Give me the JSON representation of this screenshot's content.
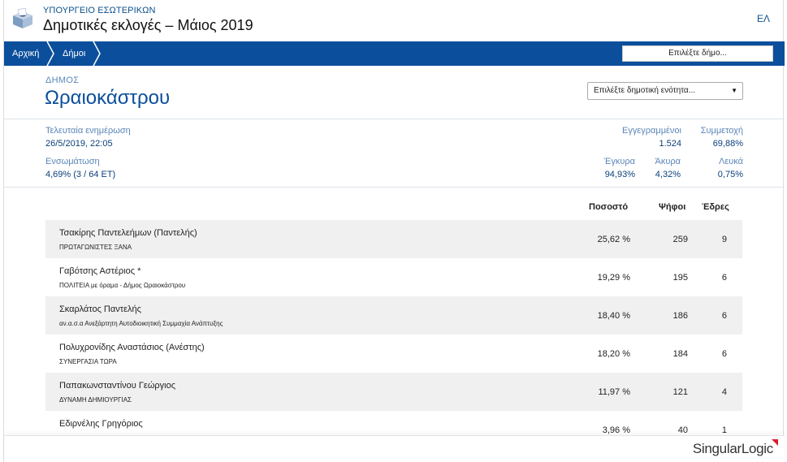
{
  "header": {
    "ministry": "ΥΠΟΥΡΓΕΙΟ ΕΣΩΤΕΡΙΚΩΝ",
    "title": "Δημοτικές εκλογές – Μάιος 2019",
    "language": "ΕΛ",
    "logo_icon": "ballot-box-icon"
  },
  "nav": {
    "breadcrumbs": [
      "Αρχική",
      "Δήμοι"
    ],
    "municipality_select_placeholder": "Επιλέξτε δήμο..."
  },
  "municipality": {
    "label": "ΔΗΜΟΣ",
    "name": "Ωραιοκάστρου",
    "unit_select_placeholder": "Επιλέξτε δημοτική ενότητα..."
  },
  "stats": {
    "last_update_label": "Τελευταία ενημέρωση",
    "last_update_value": "26/5/2019, 22:05",
    "integration_label": "Ενσωμάτωση",
    "integration_value": "4,69% (3 / 64 ΕΤ)",
    "registered_label": "Εγγεγραμμένοι",
    "registered_value": "1.524",
    "turnout_label": "Συμμετοχή",
    "turnout_value": "69,88%",
    "valid_label": "Έγκυρα",
    "valid_value": "94,93%",
    "invalid_label": "Άκυρα",
    "invalid_value": "4,32%",
    "blank_label": "Λευκά",
    "blank_value": "0,75%"
  },
  "results": {
    "columns": [
      "Ποσοστό",
      "Ψήφοι",
      "Έδρες"
    ],
    "rows": [
      {
        "candidate": "Τσακίρης Παντελεήμων (Παντελής)",
        "party": "ΠΡΩΤΑΓΩΝΙΣΤΕΣ ΞΑΝΑ",
        "percent": "25,62 %",
        "votes": "259",
        "seats": "9"
      },
      {
        "candidate": "Γαβότσης Αστέριος *",
        "party": "ΠΟΛΙΤΕΙΑ με όραμα - Δήμος Ωραιοκάστρου",
        "percent": "19,29 %",
        "votes": "195",
        "seats": "6"
      },
      {
        "candidate": "Σκαρλάτος Παντελής",
        "party": "αν.α.σ.α Ανεξάρτητη Αυτοδιοικητική Συμμαχία Ανάπτυξης",
        "percent": "18,40 %",
        "votes": "186",
        "seats": "6"
      },
      {
        "candidate": "Πολυχρονίδης Αναστάσιος (Ανέστης)",
        "party": "ΣΥΝΕΡΓΑΣΙΑ ΤΩΡΑ",
        "percent": "18,20 %",
        "votes": "184",
        "seats": "6"
      },
      {
        "candidate": "Παπακωνσταντίνου Γεώργιος",
        "party": "ΔΥΝΑΜΗ ΔΗΜΙΟΥΡΓΙΑΣ",
        "percent": "11,97 %",
        "votes": "121",
        "seats": "4"
      },
      {
        "candidate": "Εδιρνέλης Γρηγόριος",
        "party": "",
        "percent": "3,96 %",
        "votes": "40",
        "seats": "1"
      }
    ]
  },
  "footer": {
    "brand_singular": "Singular",
    "brand_logic": "Logic"
  },
  "colors": {
    "primary": "#0b4f9c",
    "label": "#5b86b8",
    "row_shade": "#f0f0f0",
    "brand_accent": "#d81e2c"
  }
}
